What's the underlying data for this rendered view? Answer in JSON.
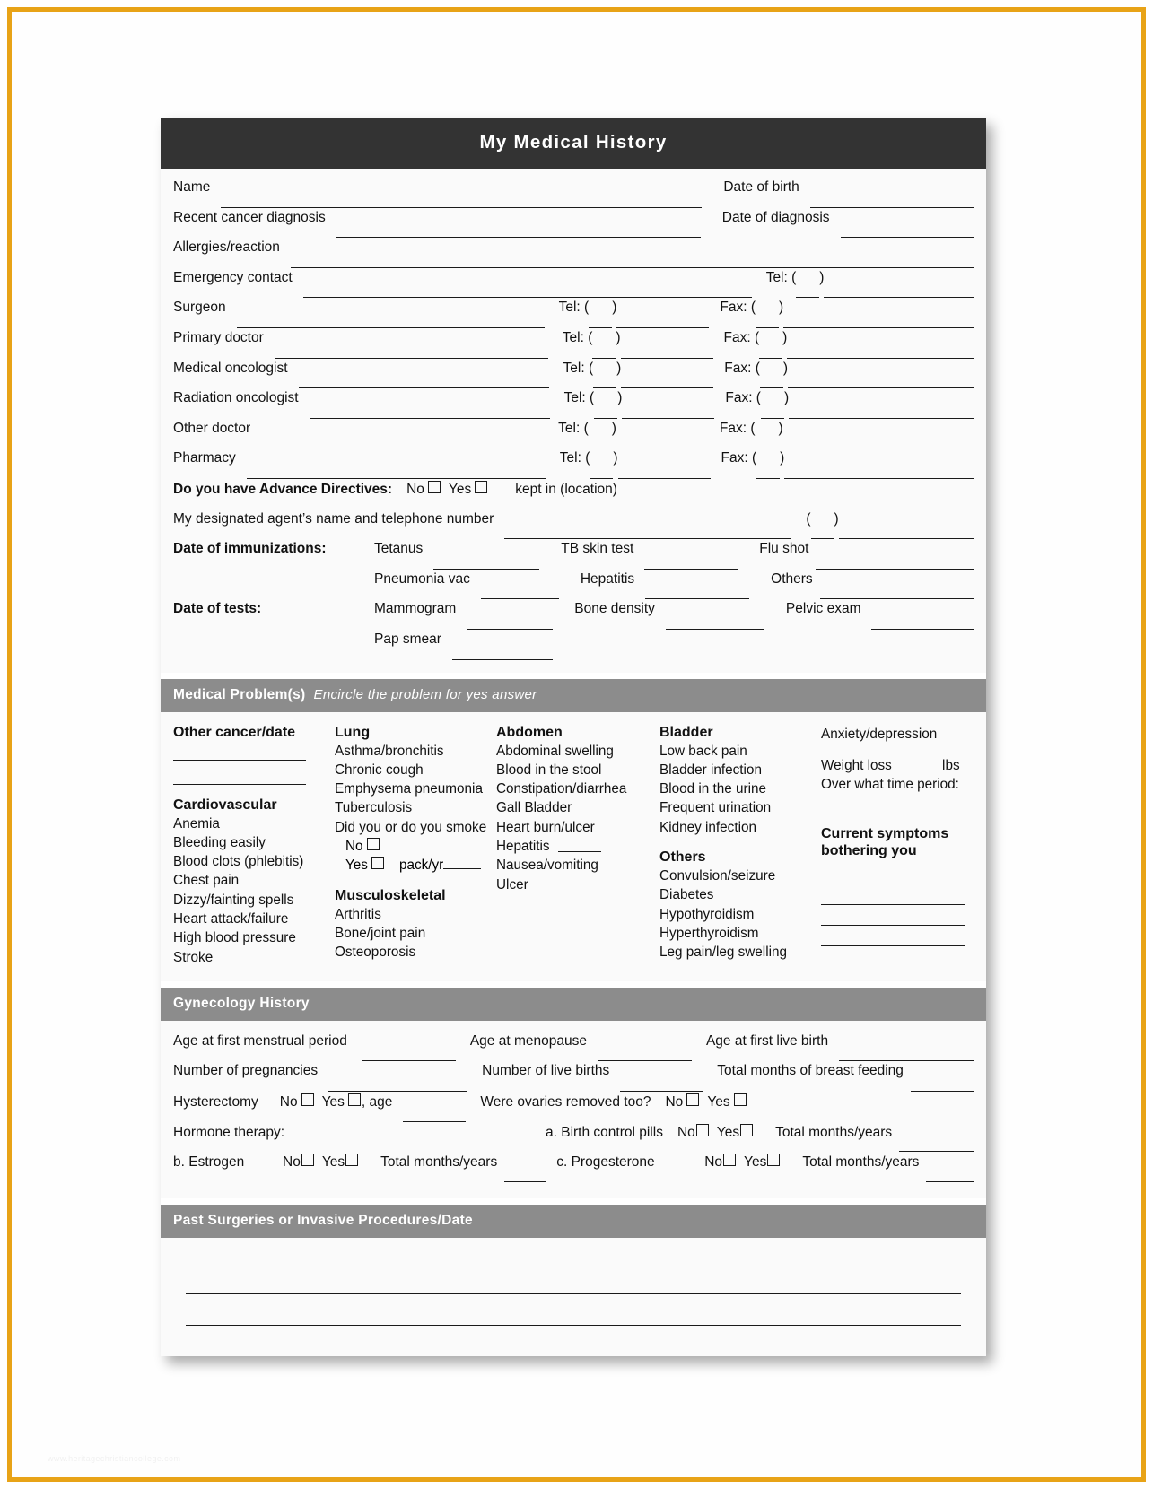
{
  "watermark": "www.heritagechristiancollege.com",
  "header": {
    "title": "My Medical History"
  },
  "contact": {
    "name_label": "Name",
    "dob_label": "Date of birth",
    "recent_cancer_label": "Recent cancer diagnosis",
    "date_diagnosis_label": "Date of diagnosis",
    "allergies_label": "Allergies/reaction",
    "emergency_label": "Emergency contact",
    "tel_label": "Tel: (",
    "tel_close": ")",
    "fax_label": "Fax: (",
    "fax_close": ")",
    "providers": [
      {
        "label": "Surgeon"
      },
      {
        "label": "Primary doctor"
      },
      {
        "label": "Medical oncologist"
      },
      {
        "label": "Radiation oncologist"
      },
      {
        "label": "Other doctor"
      },
      {
        "label": "Pharmacy"
      }
    ]
  },
  "directives": {
    "question": "Do you have Advance Directives:",
    "no_label": "No",
    "yes_label": "Yes",
    "kept_label": "kept in (location)",
    "agent_label": "My designated agent’s name and telephone number",
    "paren_open": "(",
    "paren_close": ")"
  },
  "immunizations": {
    "title": "Date of immunizations:",
    "row1": [
      {
        "label": "Tetanus"
      },
      {
        "label": "TB skin test"
      },
      {
        "label": "Flu shot"
      }
    ],
    "row2": [
      {
        "label": "Pneumonia vac"
      },
      {
        "label": "Hepatitis"
      },
      {
        "label": "Others"
      }
    ]
  },
  "tests": {
    "title": "Date of tests:",
    "row1": [
      {
        "label": "Mammogram"
      },
      {
        "label": "Bone density"
      },
      {
        "label": "Pelvic exam"
      }
    ],
    "row2": [
      {
        "label": "Pap smear"
      }
    ]
  },
  "medical_problems": {
    "bar_title": "Medical Problem(s)",
    "bar_subtitle": "Encircle the problem for yes answer",
    "col1": {
      "heading1": "Other cancer/date",
      "heading2": "Cardiovascular",
      "items": [
        "Anemia",
        "Bleeding easily",
        "Blood clots (phlebitis)",
        "Chest pain",
        "Dizzy/fainting spells",
        "Heart attack/failure",
        "High blood pressure",
        "Stroke"
      ]
    },
    "col2": {
      "heading1": "Lung",
      "items": [
        "Asthma/bronchitis",
        "Chronic cough",
        "Emphysema pneumonia",
        "Tuberculosis",
        "Did you or do you smoke"
      ],
      "smoke_no": "No",
      "smoke_yes": "Yes",
      "pack_label": "pack/yr",
      "heading2": "Musculoskeletal",
      "items2": [
        "Arthritis",
        "Bone/joint pain",
        "Osteoporosis"
      ]
    },
    "col3": {
      "heading1": "Abdomen",
      "items": [
        "Abdominal swelling",
        "Blood in the stool",
        "Constipation/diarrhea",
        "Gall Bladder",
        "Heart burn/ulcer"
      ],
      "hepatitis_label": "Hepatitis",
      "items2": [
        "Nausea/vomiting",
        "Ulcer"
      ]
    },
    "col4": {
      "heading1": "Bladder",
      "items": [
        "Low back pain",
        "Bladder infection",
        "Blood in the urine",
        "Frequent urination",
        "Kidney infection"
      ],
      "heading2": "Others",
      "items2": [
        "Convulsion/seizure",
        "Diabetes",
        "Hypothyroidism",
        "Hyperthyroidism",
        "Leg pain/leg swelling"
      ]
    },
    "col5": {
      "anxiety": "Anxiety/depression",
      "weight_loss": "Weight loss",
      "lbs": "lbs",
      "time_period": "Over what time period:",
      "current_symptoms_1": "Current symptoms",
      "current_symptoms_2": "bothering you"
    }
  },
  "gynecology": {
    "bar_title": "Gynecology History",
    "row1": [
      {
        "label": "Age at first menstrual period"
      },
      {
        "label": "Age at menopause"
      },
      {
        "label": "Age at first live birth"
      }
    ],
    "row2": [
      {
        "label": "Number of pregnancies"
      },
      {
        "label": "Number of live births"
      },
      {
        "label": "Total months of breast feeding"
      }
    ],
    "hysterectomy_label": "Hysterectomy",
    "no_label": "No",
    "yes_label": "Yes",
    "age_label": ", age",
    "ovaries_label": "Were ovaries removed too?",
    "hormone_label": "Hormone therapy:",
    "birth_control_label": "a. Birth control pills",
    "total_months_label": "Total months/years",
    "estrogen_label": "b. Estrogen",
    "progesterone_label": "c. Progesterone"
  },
  "surgeries": {
    "bar_title": "Past Surgeries or Invasive Procedures/Date"
  },
  "colors": {
    "page_border": "#e8a317",
    "header_bg": "#333333",
    "section_bar_bg": "#8c8c8c",
    "sheet_bg": "#fafafa",
    "rule": "#1a1a1a"
  }
}
